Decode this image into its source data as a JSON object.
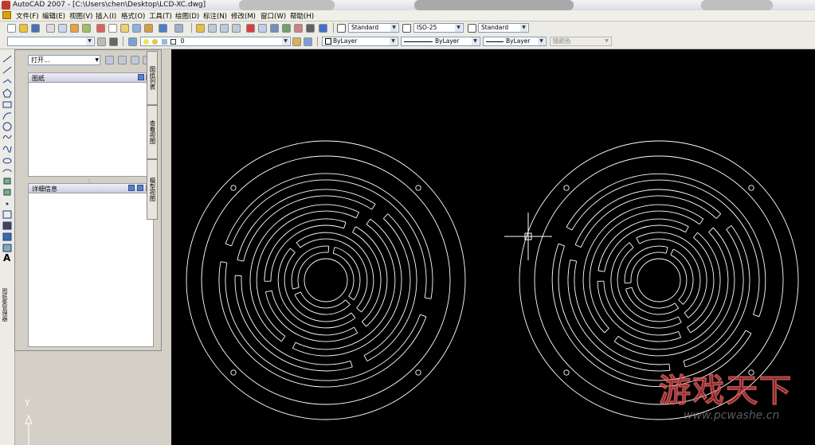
{
  "window": {
    "title": "AutoCAD 2007 - [C:\\Users\\chen\\Desktop\\LCD-XC.dwg]"
  },
  "menu": [
    "文件(F)",
    "编辑(E)",
    "视图(V)",
    "插入(I)",
    "格式(O)",
    "工具(T)",
    "绘图(D)",
    "标注(N)",
    "修改(M)",
    "窗口(W)",
    "帮助(H)"
  ],
  "styles_toolbar": {
    "text_style": "Standard",
    "dim_style": "ISO-25",
    "table_style": "Standard"
  },
  "layers_toolbar": {
    "layer_value": "0",
    "workspace_value": ""
  },
  "properties_toolbar": {
    "color": "ByLayer",
    "linetype": "ByLayer",
    "lineweight": "ByLayer",
    "plotstyle": "随颜色"
  },
  "design_center": {
    "open_label": "打开...",
    "drawings_title": "图纸",
    "details_title": "详细信息",
    "tabs": [
      "图纸列表",
      "查看视图",
      "模型视图"
    ],
    "side_label": "图纸集管理器"
  },
  "ucs": {
    "y_label": "Y"
  },
  "watermark": {
    "text": "游戏天下",
    "url": "www.pcwashe.cn"
  },
  "colors": {
    "canvas": "#000000",
    "drawing_lines": "#ffffff",
    "toolbar_bg": "#ecebe5"
  }
}
